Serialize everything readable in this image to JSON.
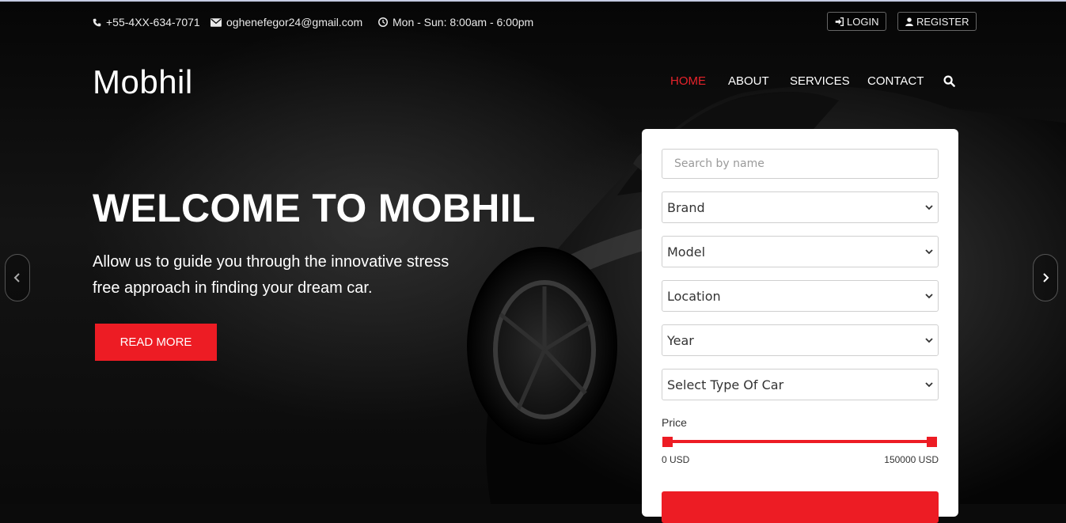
{
  "colors": {
    "accent": "#ed1c24",
    "background": "#0b0b0b",
    "panel": "#ffffff"
  },
  "topbar": {
    "phone": "+55-4XX-634-7071",
    "email": "oghenefegor24@gmail.com",
    "hours": "Mon - Sun: 8:00am - 6:00pm",
    "login_label": "LOGIN",
    "register_label": "REGISTER"
  },
  "brand": {
    "logo": "Mobhil"
  },
  "nav": {
    "items": [
      {
        "label": "HOME",
        "active": true
      },
      {
        "label": "ABOUT",
        "active": false
      },
      {
        "label": "SERVICES",
        "active": false
      },
      {
        "label": "CONTACT",
        "active": false
      }
    ],
    "search_icon": "search-icon"
  },
  "hero": {
    "headline": "WELCOME TO MOBHIL",
    "subtext": "Allow us to guide you through the innovative stress free approach in finding your dream car.",
    "cta_label": "READ MORE"
  },
  "search_panel": {
    "search_placeholder": "Search by name",
    "selects": [
      "Brand",
      "Model",
      "Location",
      "Year",
      "Select Type Of Car"
    ],
    "price_label": "Price",
    "price_min": "0 USD",
    "price_max": "150000 USD"
  }
}
